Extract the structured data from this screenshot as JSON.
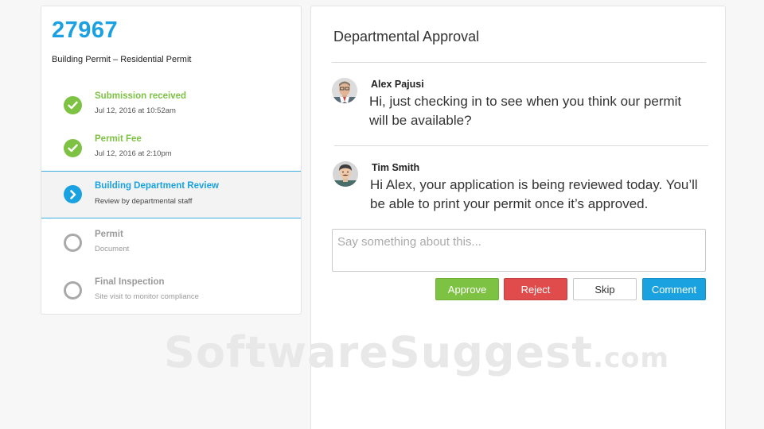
{
  "permit": {
    "number": "27967",
    "type": "Building Permit – Residential Permit"
  },
  "steps": [
    {
      "title": "Submission received",
      "subtitle": "Jul 12, 2016 at 10:52am",
      "status": "done"
    },
    {
      "title": "Permit Fee",
      "subtitle": "Jul 12, 2016 at 2:10pm",
      "status": "done"
    },
    {
      "title": "Building Department Review",
      "subtitle": "Review by departmental staff",
      "status": "current"
    },
    {
      "title": "Permit",
      "subtitle": "Document",
      "status": "pending"
    },
    {
      "title": "Final Inspection",
      "subtitle": "Site visit to monitor compliance",
      "status": "pending"
    }
  ],
  "approval": {
    "title": "Departmental Approval",
    "messages": [
      {
        "name": "Alex Pajusi",
        "text": "Hi, just checking in to see when you think our permit will be available?",
        "avatar": "avatar-alex"
      },
      {
        "name": "Tim Smith",
        "text": "Hi Alex, your application is being reviewed today. You’ll be able to print your permit once it’s approved.",
        "avatar": "avatar-tim"
      }
    ],
    "comment_placeholder": "Say something about this...",
    "buttons": {
      "approve": "Approve",
      "reject": "Reject",
      "skip": "Skip",
      "comment": "Comment"
    }
  },
  "watermark": {
    "main": "SoftwareSuggest",
    "suffix": ".com"
  },
  "colors": {
    "accent_blue": "#1aa2e0",
    "done_green": "#7dc243",
    "reject_red": "#e04c4c",
    "pending_gray": "#9a9a9a"
  }
}
